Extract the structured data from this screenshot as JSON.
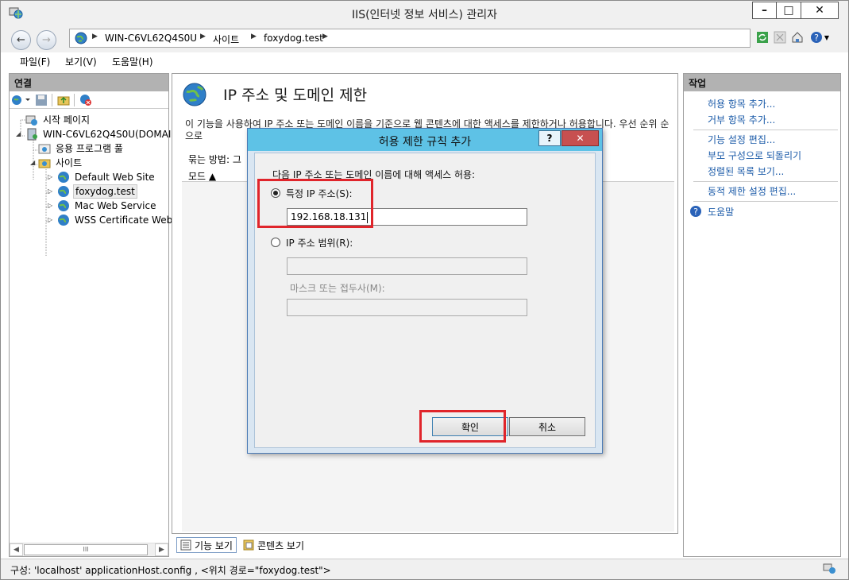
{
  "window": {
    "title": "IIS(인터넷 정보 서비스) 관리자",
    "min": "–",
    "max": "□",
    "close": "✕"
  },
  "address": {
    "crumbs": [
      "WIN-C6VL62Q4S0U",
      "사이트",
      "foxydog.test"
    ]
  },
  "menu": {
    "file": "파일(F)",
    "view": "보기(V)",
    "help": "도움말(H)"
  },
  "left": {
    "header": "연결",
    "tree": {
      "start": "시작 페이지",
      "server": "WIN-C6VL62Q4S0U(DOMAIN",
      "apppools": "응용 프로그램 풀",
      "sites": "사이트",
      "site1": "Default Web Site",
      "site2": "foxydog.test",
      "site3": "Mac Web Service",
      "site4": "WSS Certificate Web S"
    },
    "scroll_thumb": "III"
  },
  "center": {
    "title": "IP 주소 및 도메인 제한",
    "desc": "이 기능을 사용하여 IP 주소 또는 도메인 이름을 기준으로 웹 콘텐츠에 대한 액세스를 제한하거나 허용합니다. 우선 순위 순으로",
    "group_by": "묶는 방법:  그",
    "col_mode": "모드 ▲",
    "tab_features": "기능 보기",
    "tab_content": "콘텐츠 보기"
  },
  "right": {
    "header": "작업",
    "actions": [
      "허용 항목 추가...",
      "거부 항목 추가...",
      "기능 설정 편집...",
      "부모 구성으로 되돌리기",
      "정렬된 목록 보기...",
      "동적 제한 설정 편집...",
      "도움말"
    ]
  },
  "status": {
    "text": "구성: 'localhost' applicationHost.config , <위치 경로=\"foxydog.test\">"
  },
  "dialog": {
    "title": "허용 제한 규칙 추가",
    "help": "?",
    "close": "✕",
    "instruction": "다음 IP 주소 또는 도메인 이름에 대해 액세스 허용:",
    "specific_ip_label": "특정 IP 주소(S):",
    "specific_ip_value": "192.168.18.131",
    "range_label": "IP 주소 범위(R):",
    "range_value": "",
    "mask_label": "마스크 또는 접두사(M):",
    "mask_value": "",
    "ok": "확인",
    "cancel": "취소"
  },
  "colors": {
    "dialog_title": "#5ec2e6",
    "highlight": "#e0252b",
    "link": "#1a5aa8",
    "panel_header": "#b2b2b2"
  }
}
